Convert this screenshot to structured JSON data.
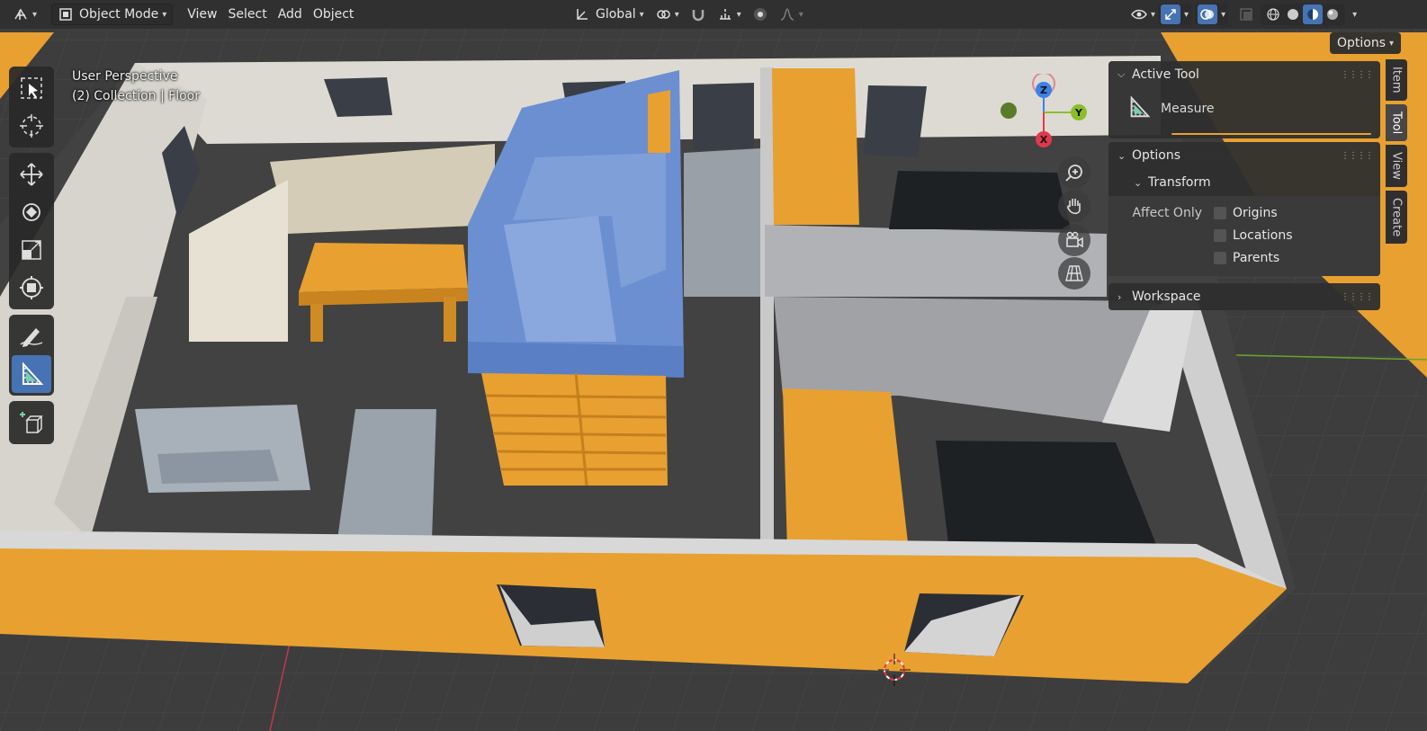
{
  "header": {
    "mode": "Object Mode",
    "menus": [
      "View",
      "Select",
      "Add",
      "Object"
    ],
    "orientation": "Global"
  },
  "viewport": {
    "perspective": "User Perspective",
    "collection": "(2) Collection | Floor",
    "options_label": "Options"
  },
  "gizmo": {
    "z": "Z",
    "y": "Y",
    "x": "X"
  },
  "panel": {
    "active_tool_title": "Active Tool",
    "tool_name": "Measure",
    "options_title": "Options",
    "transform_title": "Transform",
    "affect_only_label": "Affect Only",
    "checkboxes": [
      "Origins",
      "Locations",
      "Parents"
    ],
    "workspace_title": "Workspace"
  },
  "tabs": [
    "Item",
    "Tool",
    "View",
    "Create"
  ],
  "colors": {
    "accent": "#4772b3",
    "orange": "#e8a030",
    "blue_walls": "#6b8fd0",
    "axis_x": "#e2384d",
    "axis_y": "#8bbf29",
    "axis_z": "#3c80e8"
  }
}
